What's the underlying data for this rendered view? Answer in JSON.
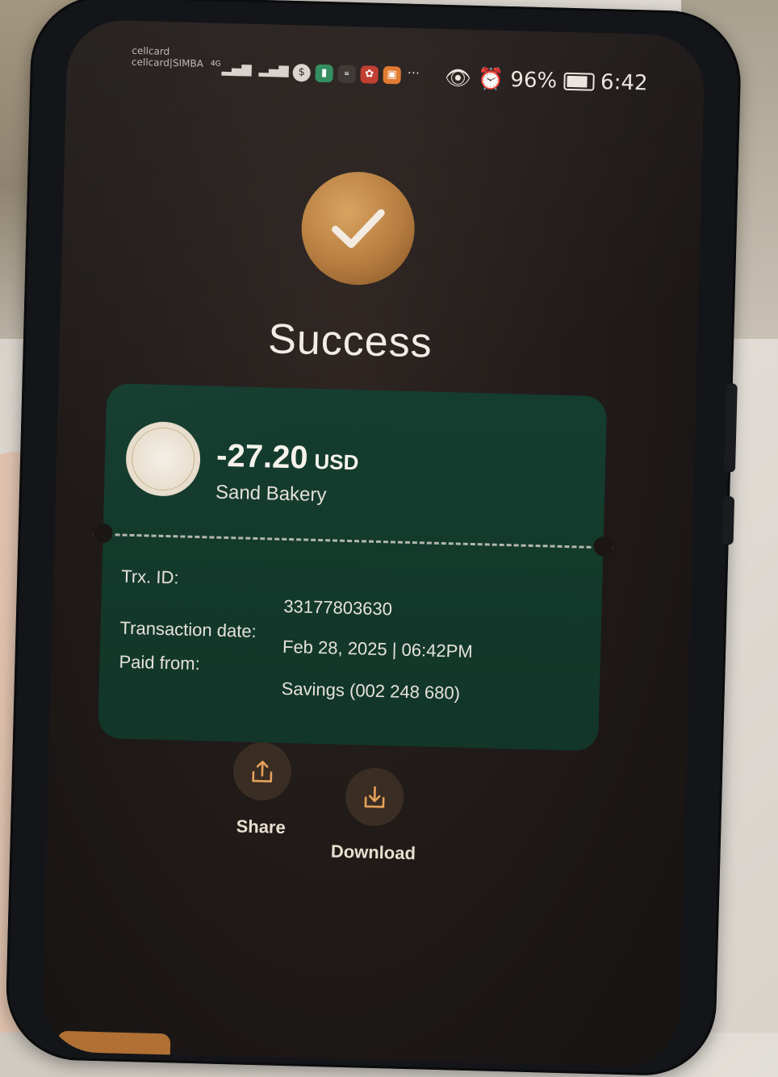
{
  "status_bar": {
    "carrier_1": "cellcard",
    "carrier_2": "cellcard|SIMBA",
    "network": "4G",
    "battery_percent": "96%",
    "battery_level": 0.96,
    "time": "6:42",
    "icons": [
      "signal-icon",
      "signal-icon",
      "dollar-app-icon",
      "app-icon",
      "app-icon",
      "app-icon",
      "app-icon",
      "more-icon",
      "eye-icon",
      "alarm-icon",
      "battery-icon"
    ]
  },
  "header": {
    "title": "Success"
  },
  "receipt": {
    "amount": "-27.20",
    "currency": "USD",
    "merchant": "Sand Bakery",
    "rows": [
      {
        "label": "Trx. ID:",
        "value": "33177803630"
      },
      {
        "label": "Transaction date:",
        "value": "Feb 28, 2025 | 06:42PM"
      },
      {
        "label": "Paid from:",
        "value": "Savings (002 248 680)"
      }
    ]
  },
  "actions": {
    "share_label": "Share",
    "download_label": "Download"
  },
  "colors": {
    "accent_gold": "#c48a48",
    "card_green": "#153d2f",
    "screen_bg": "#211b19"
  }
}
